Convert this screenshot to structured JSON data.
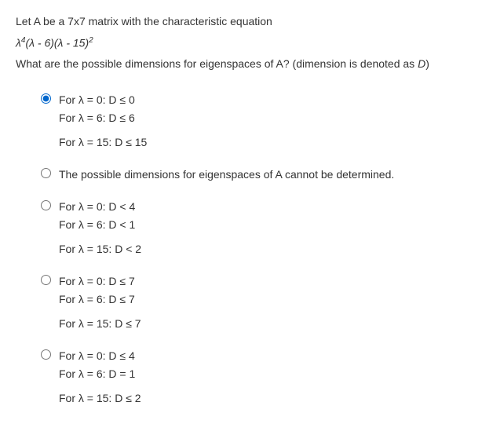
{
  "question": {
    "intro": "Let A be a 7x7 matrix with the characteristic equation",
    "equation_raw": "λ⁴(λ - 6)(λ - 15)²",
    "followup_prefix": "What are the possible dimensions for eigenspaces of A? (dimension is denoted as ",
    "followup_var": "D",
    "followup_suffix": ")"
  },
  "options": [
    {
      "selected": true,
      "type": "multi",
      "lines": [
        "For λ = 0: D ≤ 0",
        "For λ = 6: D ≤ 6"
      ],
      "spaced_line": "For λ = 15: D ≤ 15"
    },
    {
      "selected": false,
      "type": "single",
      "text": "The possible dimensions for eigenspaces of A cannot be determined."
    },
    {
      "selected": false,
      "type": "multi",
      "lines": [
        "For λ = 0: D < 4",
        "For λ = 6: D < 1"
      ],
      "spaced_line": "For λ = 15: D < 2"
    },
    {
      "selected": false,
      "type": "multi",
      "lines": [
        "For λ = 0: D ≤ 7",
        "For λ = 6: D ≤ 7"
      ],
      "spaced_line": "For λ = 15: D ≤ 7"
    },
    {
      "selected": false,
      "type": "multi",
      "lines": [
        "For λ = 0: D ≤ 4",
        "For λ = 6: D = 1"
      ],
      "spaced_line": "For λ = 15: D ≤ 2"
    }
  ]
}
